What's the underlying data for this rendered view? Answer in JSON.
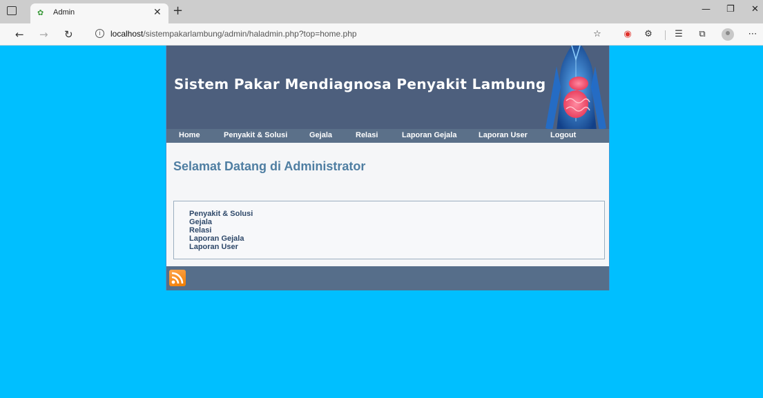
{
  "browser": {
    "tab_title": "Admin",
    "url_host": "localhost",
    "url_path": "/sistempakarlambung/admin/haladmin.php?top=home.php"
  },
  "site": {
    "banner_title": "Sistem Pakar Mendiagnosa Penyakit Lambung",
    "menu": [
      "Home",
      "Penyakit & Solusi",
      "Gejala",
      "Relasi",
      "Laporan Gejala",
      "Laporan User",
      "Logout"
    ],
    "welcome_heading": "Selamat Datang di Administrator",
    "links": [
      "Penyakit & Solusi",
      "Gejala",
      "Relasi",
      "Laporan Gejala",
      "Laporan User"
    ]
  },
  "icons": {
    "tab_favicon": "leaf-icon",
    "rss": "rss-icon",
    "anatomy": "stomach-anatomy-image"
  },
  "colors": {
    "page_background": "#00bfff",
    "banner": "#4d5f7d",
    "menubar": "#5b7089",
    "heading": "#4f7ea2",
    "footer": "#566e8a"
  }
}
